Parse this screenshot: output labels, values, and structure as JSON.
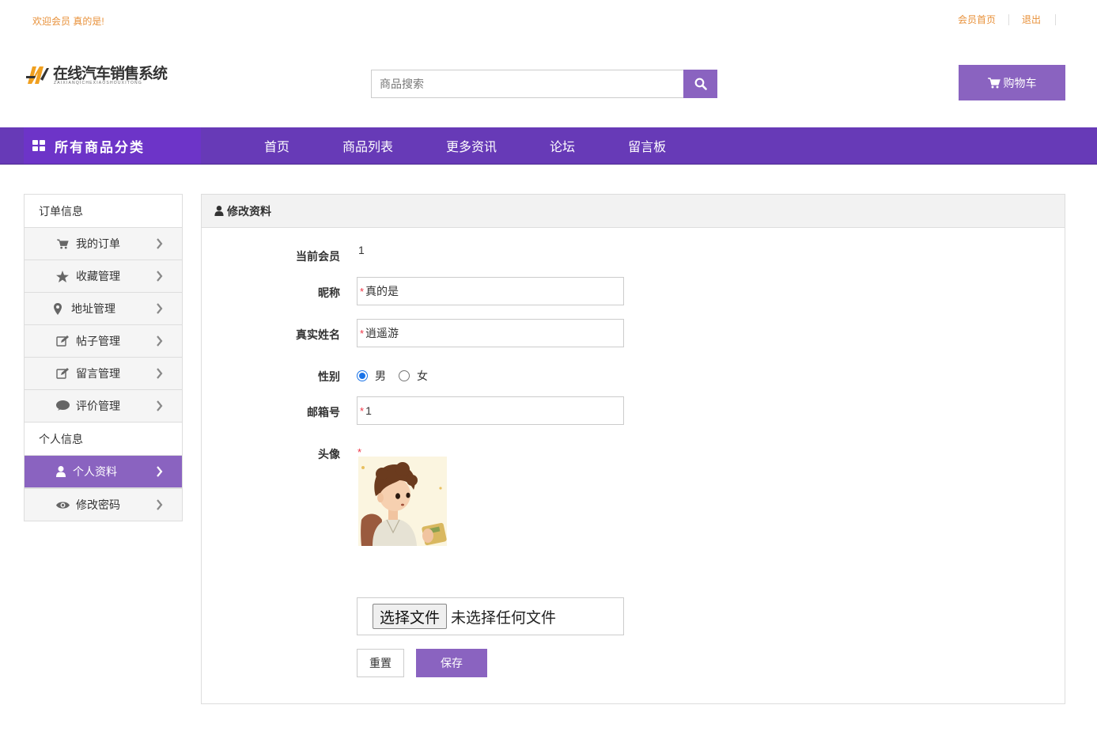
{
  "top": {
    "welcome": "欢迎会员 真的是!",
    "links": [
      "会员首页",
      "退出"
    ]
  },
  "logo": {
    "title": "在线汽车销售系统",
    "subtitle": "ZAIXIANQICHEXIAOSHOUXITONG"
  },
  "search": {
    "placeholder": "商品搜索",
    "icon": "search-icon"
  },
  "cart": {
    "label": "购物车",
    "icon": "cart-icon"
  },
  "nav": {
    "category_label": "所有商品分类",
    "items": [
      "首页",
      "商品列表",
      "更多资讯",
      "论坛",
      "留言板"
    ]
  },
  "sidebar": {
    "group1": "订单信息",
    "group1_items": [
      {
        "label": "我的订单",
        "icon": "cart-icon"
      },
      {
        "label": "收藏管理",
        "icon": "star-icon"
      },
      {
        "label": "地址管理",
        "icon": "map-pin-icon"
      },
      {
        "label": "帖子管理",
        "icon": "edit-icon"
      },
      {
        "label": "留言管理",
        "icon": "edit-icon"
      },
      {
        "label": "评价管理",
        "icon": "comment-icon"
      }
    ],
    "group2": "个人信息",
    "group2_items": [
      {
        "label": "个人资料",
        "icon": "user-icon",
        "active": true
      },
      {
        "label": "修改密码",
        "icon": "eye-icon"
      }
    ]
  },
  "panel": {
    "title": "修改资料",
    "form": {
      "member_label": "当前会员",
      "member_value": "1",
      "nickname_label": "昵称",
      "nickname_value": "真的是",
      "realname_label": "真实姓名",
      "realname_value": "逍遥游",
      "gender_label": "性别",
      "gender_options": [
        "男",
        "女"
      ],
      "gender_selected": "男",
      "email_label": "邮箱号",
      "email_value": "1",
      "avatar_label": "头像",
      "file_button": "选择文件",
      "file_status": "未选择任何文件",
      "reset_label": "重置",
      "save_label": "保存"
    }
  },
  "colors": {
    "accent": "#8a63c0",
    "nav_bg": "#673ab7",
    "top_link": "#e8913a",
    "required": "#ee3344"
  }
}
